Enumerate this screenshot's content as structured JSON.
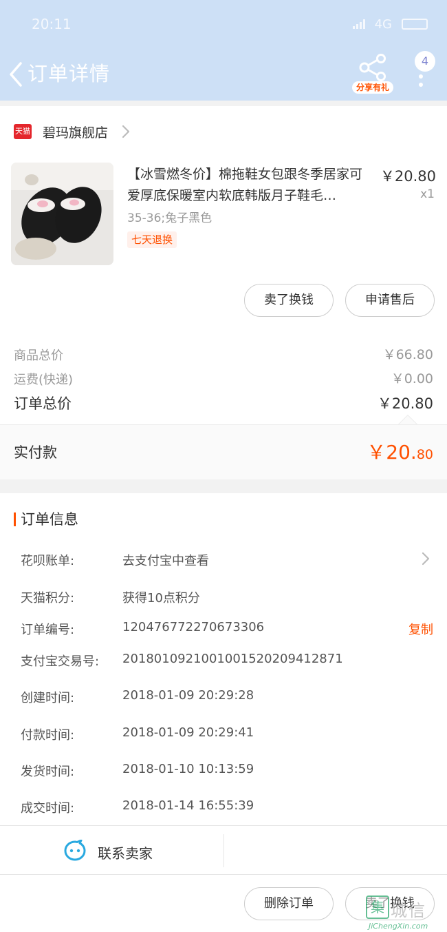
{
  "status_bar": {
    "time": "20:11",
    "network": "4G"
  },
  "header": {
    "title": "订单详情",
    "share_tag": "分享有礼",
    "badge_count": "4"
  },
  "shop": {
    "logo_text": "天猫",
    "name": "碧玛旗舰店"
  },
  "product": {
    "title": "【冰雪燃冬价】棉拖鞋女包跟冬季居家可爱厚底保暖室内软底韩版月子鞋毛…",
    "price": "￥20.80",
    "qty": "x1",
    "sku": "35-36;兔子黑色",
    "tag": "七天退换"
  },
  "item_buttons": {
    "sell": "卖了换钱",
    "after_sale": "申请售后"
  },
  "costs": {
    "goods_label": "商品总价",
    "goods_value": "￥66.80",
    "shipping_label": "运费(快递)",
    "shipping_value": "￥0.00",
    "total_label": "订单总价",
    "total_value": "￥20.80",
    "paid_label": "实付款",
    "paid_main": "￥20.",
    "paid_cents": "80"
  },
  "order_info": {
    "title": "订单信息",
    "rows": [
      {
        "label": "花呗账单:",
        "value": "去支付宝中查看"
      },
      {
        "label": "天猫积分:",
        "value": "获得10点积分"
      },
      {
        "label": "订单编号:",
        "value": "120476772270673306"
      },
      {
        "label": "支付宝交易号:",
        "value": "2018010921001001520209412871"
      },
      {
        "label": "创建时间:",
        "value": "2018-01-09 20:29:28"
      },
      {
        "label": "付款时间:",
        "value": "2018-01-09 20:29:41"
      },
      {
        "label": "发货时间:",
        "value": "2018-01-10 10:13:59"
      },
      {
        "label": "成交时间:",
        "value": "2018-01-14 16:55:39"
      }
    ],
    "copy_label": "复制"
  },
  "contact": {
    "label": "联系卖家"
  },
  "bottom_buttons": {
    "delete": "删除订单",
    "sell": "卖了换钱"
  },
  "watermark": {
    "text": "城信",
    "icon": "集",
    "url": "JiChengXin.com"
  },
  "colors": {
    "header": "#cde0f6",
    "accent": "#ff5000",
    "contact_icon": "#29a9e0"
  }
}
